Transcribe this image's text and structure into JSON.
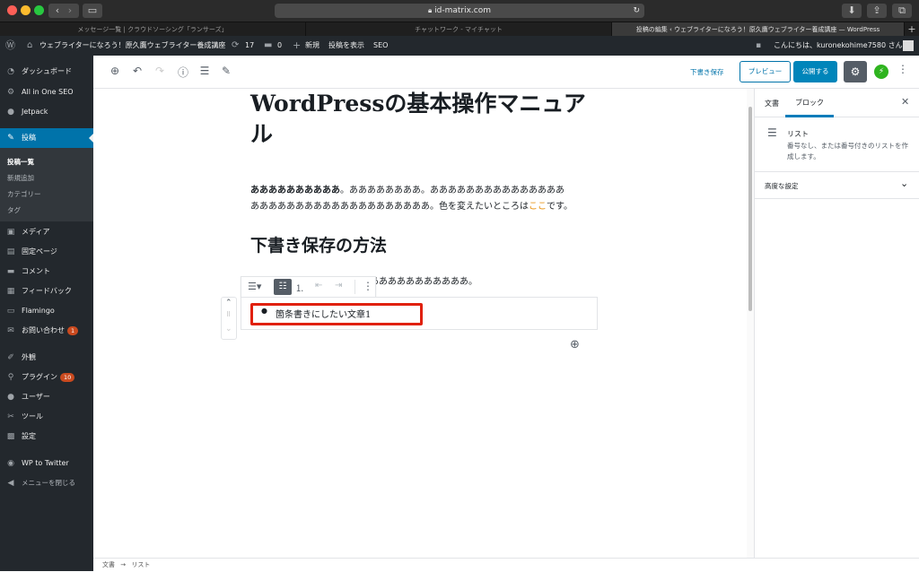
{
  "browser": {
    "url": "id-matrix.com",
    "tabs": [
      {
        "label": "メッセージ一覧 | クラウドソーシング「ランサーズ」"
      },
      {
        "label": "チャットワーク - マイチャット"
      },
      {
        "label": "投稿の編集 ‹ ウェブライターになろう！原久鷹ウェブライター養成講座 — WordPress"
      }
    ]
  },
  "adminbar": {
    "site_name": "ウェブライターになろう！原久鷹ウェブライター養成講座",
    "updates": "17",
    "comments": "0",
    "new": "新規",
    "view_post": "投稿を表示",
    "seo": "SEO",
    "greeting": "こんにちは、kuronekohime7580 さん"
  },
  "sidebar": {
    "dashboard": "ダッシュボード",
    "aioseo": "All in One SEO",
    "jetpack": "Jetpack",
    "posts": "投稿",
    "posts_sub": [
      "投稿一覧",
      "新規追加",
      "カテゴリー",
      "タグ"
    ],
    "media": "メディア",
    "pages": "固定ページ",
    "comments": "コメント",
    "feedback": "フィードバック",
    "flamingo": "Flamingo",
    "contact": "お問い合わせ",
    "contact_badge": "1",
    "appearance": "外観",
    "plugins": "プラグイン",
    "plugins_badge": "10",
    "users": "ユーザー",
    "tools": "ツール",
    "settings": "設定",
    "wp_twitter": "WP to Twitter",
    "collapse": "メニューを閉じる"
  },
  "toolbar": {
    "save_draft": "下書き保存",
    "preview": "プレビュー",
    "publish": "公開する"
  },
  "content": {
    "title_line1": "WordPressの基本操作マニュア",
    "title_line2": "ル",
    "para_bold": "ああああああああああ",
    "para_line1_rest": "。ああああああああ。あああああああああああああああ",
    "para_line2_pre": "ああああああああああああああああああああ。色を変えたいところは",
    "para_highlight": "ここ",
    "para_line2_post": "です。",
    "heading2": "下書き保存の方法",
    "para3": "ああああああああああああ。",
    "list_item": "箇条書きにしたい文章1",
    "accent_color": "#e68a00",
    "highlight_border": "#e0210d"
  },
  "panel": {
    "tab_document": "文書",
    "tab_block": "ブロック",
    "block_name": "リスト",
    "block_desc": "番号なし、または番号付きのリストを作成します。",
    "advanced": "高度な設定"
  },
  "footer": {
    "crumb_root": "文書",
    "crumb_arrow": "→",
    "crumb_leaf": "リスト"
  }
}
